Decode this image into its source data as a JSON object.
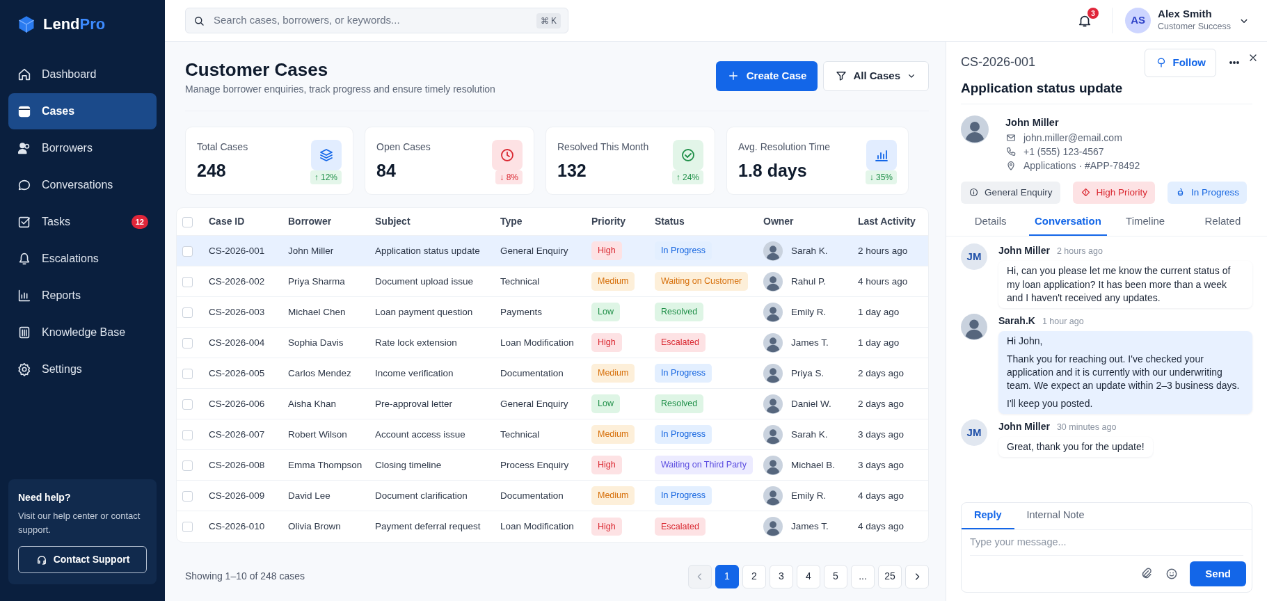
{
  "brand": {
    "name": "Lend",
    "accent": "Pro"
  },
  "sidebar": {
    "items": [
      {
        "label": "Dashboard",
        "selected": false
      },
      {
        "label": "Cases",
        "selected": true
      },
      {
        "label": "Borrowers",
        "selected": false
      },
      {
        "label": "Conversations",
        "selected": false
      },
      {
        "label": "Tasks",
        "selected": false,
        "badge": "12"
      },
      {
        "label": "Escalations",
        "selected": false
      },
      {
        "label": "Reports",
        "selected": false
      },
      {
        "label": "Knowledge Base",
        "selected": false
      },
      {
        "label": "Settings",
        "selected": false
      }
    ],
    "help": {
      "title": "Need help?",
      "text": "Visit our help center or contact support.",
      "button": "Contact Support"
    }
  },
  "topbar": {
    "search": {
      "placeholder": "Search cases, borrowers, or keywords...",
      "shortcut": "⌘ K"
    },
    "notifications": "3",
    "user": {
      "initials": "AS",
      "name": "Alex Smith",
      "role": "Customer Success"
    }
  },
  "page": {
    "title": "Customer Cases",
    "subtitle": "Manage borrower enquiries, track progress and ensure timely resolution",
    "create_button": "Create Case",
    "filter": "All Cases"
  },
  "stats": [
    {
      "label": "Total Cases",
      "value": "248",
      "change": "↑ 12%",
      "positive": true,
      "kind": "blue"
    },
    {
      "label": "Open Cases",
      "value": "84",
      "change": "↓ 8%",
      "positive": false,
      "kind": "red"
    },
    {
      "label": "Resolved This Month",
      "value": "132",
      "change": "↑ 24%",
      "positive": true,
      "kind": "green"
    },
    {
      "label": "Avg. Resolution Time",
      "value": "1.8 days",
      "change": "↓ 35%",
      "positive": true,
      "kind": "blue"
    }
  ],
  "table": {
    "all_checked": false,
    "columns": [
      "Case ID",
      "Borrower",
      "Subject",
      "Type",
      "Priority",
      "Status",
      "Owner",
      "Last Activity"
    ],
    "rows": [
      {
        "selected": true,
        "checked": false,
        "case_id": "CS-2026-001",
        "borrower": "John Miller",
        "subject": "Application status update",
        "type": "General Enquiry",
        "priority": {
          "label": "High",
          "kind": "high"
        },
        "status": {
          "label": "In Progress",
          "kind": "progress"
        },
        "owner": "Sarah K.",
        "last_activity": "2 hours ago"
      },
      {
        "selected": false,
        "checked": false,
        "case_id": "CS-2026-002",
        "borrower": "Priya Sharma",
        "subject": "Document upload issue",
        "type": "Technical",
        "priority": {
          "label": "Medium",
          "kind": "medium"
        },
        "status": {
          "label": "Waiting on Customer",
          "kind": "waiting"
        },
        "owner": "Rahul P.",
        "last_activity": "4 hours ago"
      },
      {
        "selected": false,
        "checked": false,
        "case_id": "CS-2026-003",
        "borrower": "Michael Chen",
        "subject": "Loan payment question",
        "type": "Payments",
        "priority": {
          "label": "Low",
          "kind": "low"
        },
        "status": {
          "label": "Resolved",
          "kind": "resolved"
        },
        "owner": "Emily R.",
        "last_activity": "1 day ago"
      },
      {
        "selected": false,
        "checked": false,
        "case_id": "CS-2026-004",
        "borrower": "Sophia Davis",
        "subject": "Rate lock extension",
        "type": "Loan Modification",
        "priority": {
          "label": "High",
          "kind": "high"
        },
        "status": {
          "label": "Escalated",
          "kind": "escalated"
        },
        "owner": "James T.",
        "last_activity": "1 day ago"
      },
      {
        "selected": false,
        "checked": false,
        "case_id": "CS-2026-005",
        "borrower": "Carlos Mendez",
        "subject": "Income verification",
        "type": "Documentation",
        "priority": {
          "label": "Medium",
          "kind": "medium"
        },
        "status": {
          "label": "In Progress",
          "kind": "progress"
        },
        "owner": "Priya S.",
        "last_activity": "2 days ago"
      },
      {
        "selected": false,
        "checked": false,
        "case_id": "CS-2026-006",
        "borrower": "Aisha Khan",
        "subject": "Pre-approval letter",
        "type": "General Enquiry",
        "priority": {
          "label": "Low",
          "kind": "low"
        },
        "status": {
          "label": "Resolved",
          "kind": "resolved"
        },
        "owner": "Daniel W.",
        "last_activity": "2 days ago"
      },
      {
        "selected": false,
        "checked": false,
        "case_id": "CS-2026-007",
        "borrower": "Robert Wilson",
        "subject": "Account access issue",
        "type": "Technical",
        "priority": {
          "label": "Medium",
          "kind": "medium"
        },
        "status": {
          "label": "In Progress",
          "kind": "progress"
        },
        "owner": "Sarah K.",
        "last_activity": "3 days ago"
      },
      {
        "selected": false,
        "checked": false,
        "case_id": "CS-2026-008",
        "borrower": "Emma Thompson",
        "subject": "Closing timeline",
        "type": "Process Enquiry",
        "priority": {
          "label": "High",
          "kind": "high"
        },
        "status": {
          "label": "Waiting on Third Party",
          "kind": "third_party"
        },
        "owner": "Michael B.",
        "last_activity": "3 days ago"
      },
      {
        "selected": false,
        "checked": false,
        "case_id": "CS-2026-009",
        "borrower": "David Lee",
        "subject": "Document clarification",
        "type": "Documentation",
        "priority": {
          "label": "Medium",
          "kind": "medium"
        },
        "status": {
          "label": "In Progress",
          "kind": "progress"
        },
        "owner": "Emily R.",
        "last_activity": "4 days ago"
      },
      {
        "selected": false,
        "checked": false,
        "case_id": "CS-2026-010",
        "borrower": "Olivia Brown",
        "subject": "Payment deferral request",
        "type": "Loan Modification",
        "priority": {
          "label": "High",
          "kind": "high"
        },
        "status": {
          "label": "Escalated",
          "kind": "escalated"
        },
        "owner": "James T.",
        "last_activity": "4 days ago"
      }
    ]
  },
  "pagination": {
    "summary": "Showing 1–10 of 248 cases",
    "prev_disabled": true,
    "pages": [
      {
        "label": "1",
        "selected": true
      },
      {
        "label": "2",
        "selected": false
      },
      {
        "label": "3",
        "selected": false
      },
      {
        "label": "4",
        "selected": false
      },
      {
        "label": "5",
        "selected": false
      },
      {
        "label": "...",
        "selected": false
      },
      {
        "label": "25",
        "selected": false
      }
    ]
  },
  "detail": {
    "case_id": "CS-2026-001",
    "title": "Application status update",
    "follow": "Follow",
    "contact": {
      "name": "John Miller",
      "email": "john.miller@email.com",
      "phone": "+1 (555) 123-4567",
      "reference": "Applications · #APP-78492"
    },
    "tags": [
      {
        "label": "General Enquiry",
        "kind": "neutral"
      },
      {
        "label": "High Priority",
        "kind": "danger"
      },
      {
        "label": "In Progress",
        "kind": "info"
      }
    ],
    "tabs": [
      {
        "label": "Details",
        "selected": false
      },
      {
        "label": "Conversation",
        "selected": true
      },
      {
        "label": "Timeline",
        "selected": false
      },
      {
        "label": "Related",
        "selected": false
      }
    ],
    "messages": [
      {
        "kind": "borrower",
        "initials": "JM",
        "author": "John Miller",
        "time": "2 hours ago",
        "paragraphs": [
          "Hi, can you please let me know the current status of my loan application? It has been more than a week and I haven't received any updates."
        ]
      },
      {
        "kind": "agent",
        "author": "Sarah.K",
        "time": "1 hour ago",
        "paragraphs": [
          "Hi John,",
          "Thank you for reaching out. I've checked your application and it is currently with our underwriting team. We expect an update within 2–3 business days.",
          "I'll keep you posted."
        ]
      },
      {
        "kind": "borrower",
        "initials": "JM",
        "author": "John Miller",
        "time": "30 minutes ago",
        "paragraphs": [
          "Great, thank you for the update!"
        ]
      }
    ],
    "composer": {
      "tabs": [
        {
          "label": "Reply",
          "selected": true
        },
        {
          "label": "Internal Note",
          "selected": false
        }
      ],
      "placeholder": "Type your message...",
      "send": "Send"
    }
  }
}
